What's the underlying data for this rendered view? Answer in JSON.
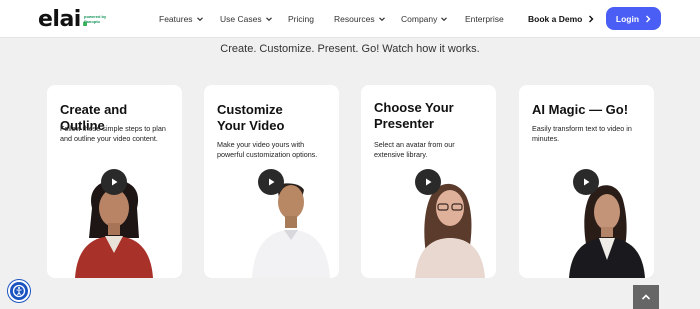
{
  "brand": {
    "logo_text": "elai",
    "logo_dot": ".",
    "powered_by": "powered by Panopto"
  },
  "nav": {
    "items": [
      {
        "label": "Features",
        "has_dropdown": true
      },
      {
        "label": "Use Cases",
        "has_dropdown": true
      },
      {
        "label": "Pricing",
        "has_dropdown": false
      },
      {
        "label": "Resources",
        "has_dropdown": true
      },
      {
        "label": "Company",
        "has_dropdown": true
      },
      {
        "label": "Enterprise",
        "has_dropdown": false
      }
    ],
    "book_demo": "Book a Demo",
    "login": "Login"
  },
  "hero": {
    "subtitle": "Create. Customize. Present. Go! Watch how it works."
  },
  "cards": [
    {
      "title": "Create and Outline",
      "description": "Follow these simple steps to plan and outline your video content.",
      "icon": "play-icon"
    },
    {
      "title": "Customize Your Video",
      "description": "Make your video yours with powerful customization options.",
      "icon": "play-icon"
    },
    {
      "title": "Choose Your Presenter",
      "description": "Select an avatar from our extensive library.",
      "icon": "play-icon"
    },
    {
      "title": "AI Magic — Go!",
      "description": "Easily transform text to video in minutes.",
      "icon": "play-icon"
    }
  ],
  "colors": {
    "accent": "#4a5ef5",
    "logo_dot": "#3bb05a",
    "background": "#f0f0f1",
    "a11y_button": "#1b54c0"
  },
  "widgets": {
    "accessibility_icon": "accessibility-icon",
    "scroll_top_icon": "chevron-up-icon"
  }
}
